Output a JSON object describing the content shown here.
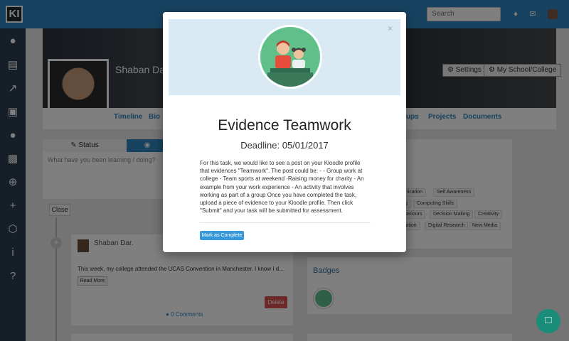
{
  "topbar": {
    "logo": "KI",
    "search_placeholder": "Search",
    "bell_icon": "bell-icon",
    "mail_icon": "mail-icon",
    "accent": "#2e86c1"
  },
  "sidebar": {
    "icons": [
      "user-icon",
      "id-card-icon",
      "chart-line-icon",
      "note-icon",
      "group-icon",
      "industry-icon",
      "crosshair-icon",
      "user-add-icon",
      "network-icon",
      "info-icon",
      "help-icon"
    ]
  },
  "profile": {
    "name": "Shaban Da",
    "settings_label": "Settings",
    "school_label": "My School/College"
  },
  "nav": {
    "tabs_left": [
      "Timeline",
      "Bio"
    ],
    "tabs_right": [
      "ups",
      "Projects",
      "Documents"
    ]
  },
  "status": {
    "tab_status": "Status",
    "placeholder": "What have you been learning / doing?",
    "close_label": "Close"
  },
  "post": {
    "author": "Shaban Dar.",
    "text": "This week, my college attended the UCAS Convention in Manchester. I know I d...",
    "read_more": "Read More",
    "delete": "Delete",
    "comments": "0 Comments"
  },
  "skills": {
    "chips": [
      "unication",
      "Self Awareness",
      "g",
      "Computing Skills",
      "haviours",
      "Decision Making",
      "Creativity",
      "vation",
      "Digital Research",
      "New Media"
    ]
  },
  "badges": {
    "title": "Badges"
  },
  "modal": {
    "close": "×",
    "title": "Evidence Teamwork",
    "deadline": "Deadline: 05/01/2017",
    "body": "For this task, we would like to see a post on your Kloodle profile that evidences \"Teamwork\". The post could be: - - Group work at college - Team sports at weekend -Raising money for charity - An example from your work experience - An activity that involves working as part of a group Once you have completed the task, upload a piece of evidence to your Kloodle profile. Then click \"Submit\" and your task will be submitted for assessment.",
    "complete_label": "Mark as Complete"
  },
  "chat": {
    "icon": "chat-icon"
  }
}
